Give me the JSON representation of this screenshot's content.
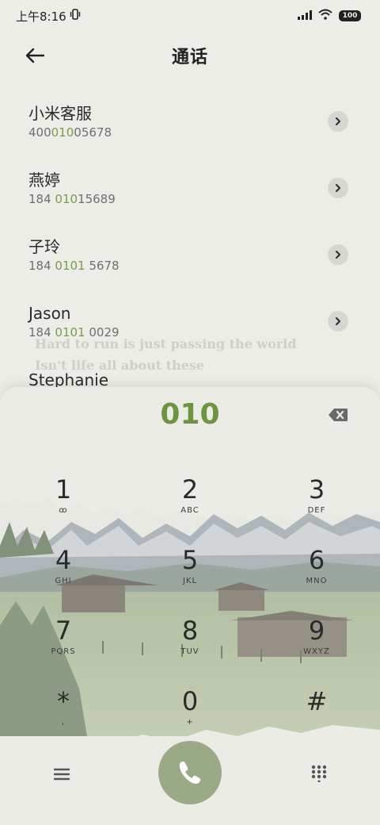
{
  "status": {
    "time": "上午8:16",
    "battery": "100"
  },
  "header": {
    "title": "通话"
  },
  "contacts": [
    {
      "name": "小米客服",
      "num_pre": "400",
      "num_hl": "010",
      "num_post": "05678"
    },
    {
      "name": "燕婷",
      "num_pre": "184 ",
      "num_hl": "010",
      "num_post": "15689"
    },
    {
      "name": "子玲",
      "num_pre": "184 ",
      "num_hl": "0101",
      "num_post": " 5678"
    },
    {
      "name": "Jason",
      "num_pre": "184 ",
      "num_hl": "0101",
      "num_post": " 0029"
    },
    {
      "name": "Stephanie",
      "num_pre": "",
      "num_hl": "",
      "num_post": ""
    }
  ],
  "quote": {
    "line1": "Hard to run is just passing the world",
    "line2": "Isn't life all about these"
  },
  "dialer": {
    "input": "010",
    "keys": [
      {
        "digit": "1",
        "letters": "ꝏ"
      },
      {
        "digit": "2",
        "letters": "ABC"
      },
      {
        "digit": "3",
        "letters": "DEF"
      },
      {
        "digit": "4",
        "letters": "GHI"
      },
      {
        "digit": "5",
        "letters": "JKL"
      },
      {
        "digit": "6",
        "letters": "MNO"
      },
      {
        "digit": "7",
        "letters": "PQRS"
      },
      {
        "digit": "8",
        "letters": "TUV"
      },
      {
        "digit": "9",
        "letters": "WXYZ"
      },
      {
        "digit": "*",
        "letters": ","
      },
      {
        "digit": "0",
        "letters": "+"
      },
      {
        "digit": "#",
        "letters": ""
      }
    ]
  },
  "colors": {
    "accent": "#6f9440",
    "call_button": "#9aa986"
  }
}
